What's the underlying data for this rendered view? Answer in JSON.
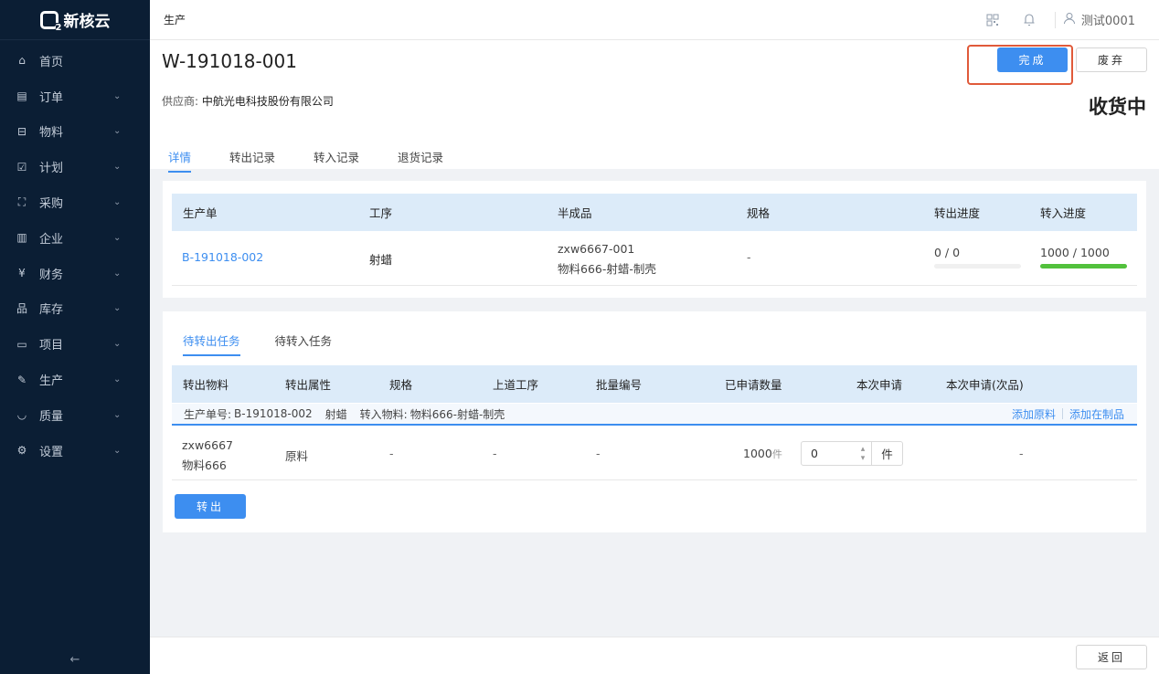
{
  "sidebar": {
    "brand": "新核云",
    "items": [
      {
        "label": "首页",
        "icon": "home-icon"
      },
      {
        "label": "订单",
        "icon": "order-icon"
      },
      {
        "label": "物料",
        "icon": "material-icon"
      },
      {
        "label": "计划",
        "icon": "plan-icon"
      },
      {
        "label": "采购",
        "icon": "purchase-icon"
      },
      {
        "label": "企业",
        "icon": "enterprise-icon"
      },
      {
        "label": "财务",
        "icon": "finance-icon"
      },
      {
        "label": "库存",
        "icon": "inventory-icon"
      },
      {
        "label": "项目",
        "icon": "project-icon"
      },
      {
        "label": "生产",
        "icon": "production-icon"
      },
      {
        "label": "质量",
        "icon": "quality-icon"
      },
      {
        "label": "设置",
        "icon": "settings-icon"
      }
    ],
    "collapse_glyph": "←"
  },
  "topbar": {
    "breadcrumb": "生产",
    "user": "测试0001"
  },
  "header": {
    "doc_id": "W-191018-001",
    "supplier_label": "供应商:",
    "supplier_name": "中航光电科技股份有限公司",
    "status": "收货中",
    "complete_label": "完成",
    "discard_label": "废弃",
    "tabs": [
      "详情",
      "转出记录",
      "转入记录",
      "退货记录"
    ]
  },
  "summary_table": {
    "headers": [
      "生产单",
      "工序",
      "半成品",
      "规格",
      "转出进度",
      "转入进度"
    ],
    "row": {
      "order": "B-191018-002",
      "process": "射蜡",
      "semi_code": "zxw6667-001",
      "semi_name": "物料666-射蜡-制壳",
      "spec": "-",
      "out_progress": "0 / 0",
      "out_fraction": 0,
      "in_progress": "1000 / 1000",
      "in_fraction": 1
    }
  },
  "tasks": {
    "tabs": [
      "待转出任务",
      "待转入任务"
    ],
    "headers": [
      "转出物料",
      "转出属性",
      "规格",
      "上道工序",
      "批量编号",
      "已申请数量",
      "本次申请",
      "本次申请(次品)"
    ],
    "group": {
      "order_label": "生产单号:",
      "order_no": "B-191018-002",
      "process": "射蜡",
      "in_material_label": "转入物料:",
      "in_material": "物料666-射蜡-制壳",
      "add_raw": "添加原料",
      "add_wip": "添加在制品"
    },
    "row": {
      "material_code": "zxw6667",
      "material_name": "物料666",
      "attr": "原料",
      "spec": "-",
      "prev_process": "-",
      "batch": "-",
      "applied_qty": "1000",
      "applied_unit": "件",
      "current_value": "0",
      "current_unit": "件",
      "defect": "-"
    },
    "transfer_label": "转出"
  },
  "footer": {
    "back_label": "返回"
  },
  "colors": {
    "sidebar_bg": "#0b1e34",
    "primary": "#3d8ef0",
    "progress_done": "#52c13c",
    "highlight": "#e05a3a"
  }
}
